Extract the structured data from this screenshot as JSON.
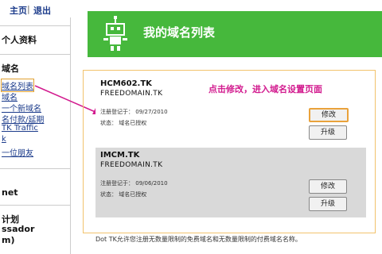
{
  "nav": {
    "home": "主页",
    "sep": "|",
    "logout": "退出"
  },
  "sidebar": {
    "personal": "个人资料",
    "domains": "域名",
    "items": [
      "域名列表",
      "域名",
      "一个新域名",
      "名付款/延期",
      "TK Traffic",
      "k",
      "一位朋友"
    ],
    "net": "net",
    "plan": "计划",
    "ambassador": "ssador",
    "m": "m)"
  },
  "banner": {
    "title": "我的域名列表"
  },
  "annotation": "点击修改，进入域名设置页面",
  "domains": [
    {
      "name": "HCM602.TK",
      "sub": "FREEDOMAIN.TK",
      "reg_label": "注册登记于：",
      "reg_date": "09/27/2010",
      "status_label": "状态：",
      "status_value": "域名已授权",
      "edit": "修改",
      "upgrade": "升级"
    },
    {
      "name": "IMCM.TK",
      "sub": "FREEDOMAIN.TK",
      "reg_label": "注册登记于：",
      "reg_date": "09/06/2010",
      "status_label": "状态：",
      "status_value": "域名已授权",
      "edit": "修改",
      "upgrade": "升级"
    }
  ],
  "footer": "Dot TK允许您注册无数量限制的免费域名和无数量限制的付费域名名称。",
  "colors": {
    "banner": "#46b83c",
    "annotation": "#d21a8e",
    "highlight": "#e9a23b"
  }
}
